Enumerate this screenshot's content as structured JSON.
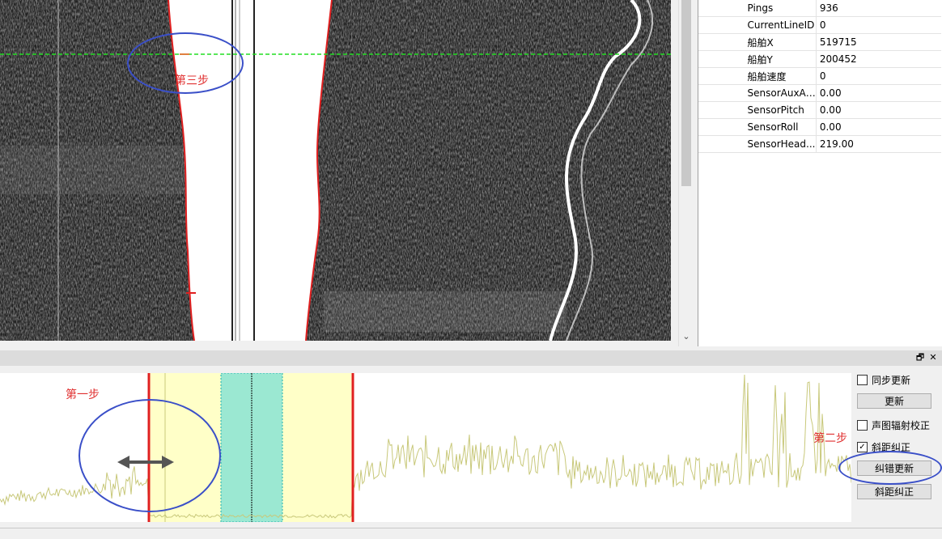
{
  "properties": [
    {
      "key": "Pings",
      "value": "936"
    },
    {
      "key": "CurrentLineID",
      "value": "0"
    },
    {
      "key": "船舶X",
      "value": "519715"
    },
    {
      "key": "船舶Y",
      "value": "200452"
    },
    {
      "key": "船舶速度",
      "value": "0"
    },
    {
      "key": "SensorAuxAl...",
      "value": "0.00"
    },
    {
      "key": "SensorPitch",
      "value": "0.00"
    },
    {
      "key": "SensorRoll",
      "value": "0.00"
    },
    {
      "key": "SensorHead...",
      "value": "219.00"
    }
  ],
  "controls": {
    "sync_update_label": "同步更新",
    "sync_update_checked": false,
    "update_button": "更新",
    "radiometric_label": "声图辐射校正",
    "radiometric_checked": false,
    "slant_label": "斜距纠正",
    "slant_checked": true,
    "error_update_button": "纠错更新",
    "slant_correct_button": "斜距纠正"
  },
  "annotations": {
    "step1": "第一步",
    "step2": "第二步",
    "step3": "第三步"
  },
  "dock_buttons": {
    "restore": "🗗",
    "close": "✕"
  },
  "colors": {
    "waveform": "#c8c87a",
    "highlight": "#ffffc8",
    "bottom_track": "#e02020",
    "nadir_band": "#58d8d8",
    "annotation_circle": "#3a4fc8",
    "annotation_text": "#e03030",
    "ping_line": "#22dd22"
  }
}
